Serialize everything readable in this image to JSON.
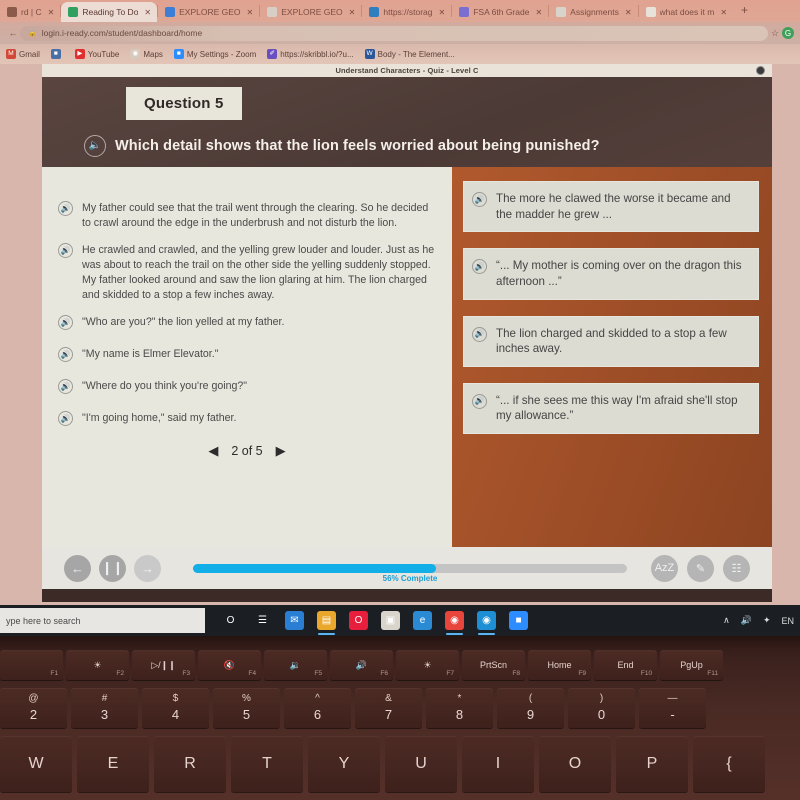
{
  "browser": {
    "tabs": [
      {
        "label": "rd | C",
        "favicon": "favicon-generic",
        "color": "#8a5a4a",
        "active": false,
        "close": "✕"
      },
      {
        "label": "Reading To Do",
        "favicon": "favicon-iready",
        "color": "#2fa05f",
        "active": true,
        "close": "✕"
      },
      {
        "label": "EXPLORE GEO",
        "favicon": "favicon-explore",
        "color": "#3d7fd6",
        "active": false,
        "close": "✕"
      },
      {
        "label": "EXPLORE GEO",
        "favicon": "favicon-doc",
        "color": "#d7cfc6",
        "active": false,
        "close": "✕"
      },
      {
        "label": "https://storag",
        "favicon": "favicon-globe",
        "color": "#2f7fbf",
        "active": false,
        "close": "✕"
      },
      {
        "label": "FSA 6th Grade",
        "favicon": "favicon-people",
        "color": "#7a6fd0",
        "active": false,
        "close": "✕"
      },
      {
        "label": "Assignments",
        "favicon": "favicon-word",
        "color": "#d9d4cb",
        "active": false,
        "close": "✕"
      },
      {
        "label": "what does it m",
        "favicon": "favicon-google",
        "color": "#e8e3da",
        "active": false,
        "close": "✕"
      }
    ],
    "new_tab_label": "+",
    "address": "login.i-ready.com/student/dashboard/home",
    "lock_icon": "🔒",
    "star_icon": "☆",
    "profile_initial": "G",
    "bookmarks": [
      {
        "label": "Gmail",
        "icon": "M",
        "color": "#d14836"
      },
      {
        "label": "",
        "icon": "■",
        "color": "#4a6fa5"
      },
      {
        "label": "YouTube",
        "icon": "▶",
        "color": "#e02f2f"
      },
      {
        "label": "Maps",
        "icon": "◉",
        "color": "#d8c9bd"
      },
      {
        "label": "My Settings - Zoom",
        "icon": "■",
        "color": "#2d8cff"
      },
      {
        "label": "https://skribbl.io/?u...",
        "icon": "✐",
        "color": "#6a4fc0"
      },
      {
        "label": "Body - The Element...",
        "icon": "W",
        "color": "#2b579a"
      }
    ]
  },
  "app": {
    "title": "Understand Characters - Quiz - Level C",
    "close_icon": "✕",
    "question_badge": "Question 5",
    "prompt": "Which detail shows that the lion feels worried about being punished?",
    "speaker_glyph": "🔊",
    "passage": [
      "My father could see that the trail went through the clearing. So he decided to crawl around the edge in the underbrush and not disturb the lion.",
      "He crawled and crawled, and the yelling grew louder and louder. Just as he was about to reach the trail on the other side the yelling suddenly stopped. My father looked around and saw the lion glaring at him. The lion charged and skidded to a stop a few inches away.",
      "\"Who are you?\" the lion yelled at my father.",
      "\"My name is Elmer Elevator.\"",
      "\"Where do you think you're going?\"",
      "\"I'm going home,\" said my father."
    ],
    "pager": {
      "prev_icon": "◀",
      "label": "2 of 5",
      "next_icon": "▶"
    },
    "choices": [
      "The more he clawed the worse it became and the madder he grew ...",
      "“... My mother is coming over on the dragon this afternoon ...”",
      "The lion charged and skidded to a stop a few inches away.",
      "“... if she sees me this way I'm afraid she'll stop my allowance.”"
    ],
    "footer": {
      "back_icon": "←",
      "pause_icon": "❙❙",
      "forward_icon": "→",
      "progress_percent": 56,
      "progress_label": "56% Complete",
      "progress_color": "#12aee8",
      "tools": [
        {
          "name": "dictionary-tool",
          "glyph": "AzZ"
        },
        {
          "name": "highlighter-tool",
          "glyph": "✎"
        },
        {
          "name": "notepad-tool",
          "glyph": "☷"
        }
      ]
    }
  },
  "taskbar": {
    "search_placeholder": "ype here to search",
    "apps": [
      {
        "name": "cortana",
        "glyph": "O",
        "color": "transparent",
        "active": false
      },
      {
        "name": "task-view",
        "glyph": "☰",
        "color": "transparent",
        "active": false
      },
      {
        "name": "mail",
        "glyph": "✉",
        "color": "#2a7fd4",
        "active": false
      },
      {
        "name": "file-explorer",
        "glyph": "▤",
        "color": "#e9a72c",
        "active": true
      },
      {
        "name": "opera",
        "glyph": "O",
        "color": "#e81e3d",
        "active": false
      },
      {
        "name": "store",
        "glyph": "▣",
        "color": "#d9d5cc",
        "active": false
      },
      {
        "name": "edge",
        "glyph": "e",
        "color": "#2a8ad4",
        "active": false
      },
      {
        "name": "chrome",
        "glyph": "◉",
        "color": "#e8453c",
        "active": true
      },
      {
        "name": "skype",
        "glyph": "◉",
        "color": "#1e8fd4",
        "active": true
      },
      {
        "name": "zoom",
        "glyph": "■",
        "color": "#2d8cff",
        "active": false
      }
    ],
    "tray": [
      {
        "name": "show-hidden-icons",
        "glyph": "∧"
      },
      {
        "name": "volume-icon",
        "glyph": "🔊"
      },
      {
        "name": "bluetooth-icon",
        "glyph": "✦"
      },
      {
        "name": "language-indicator",
        "glyph": "EN"
      }
    ]
  },
  "keyboard": {
    "function_row": [
      {
        "main": "",
        "fk": "F1"
      },
      {
        "main": "☀",
        "fk": "F2"
      },
      {
        "main": "▷/❙❙",
        "fk": "F3"
      },
      {
        "main": "🔇",
        "fk": "F4"
      },
      {
        "main": "🔉",
        "fk": "F5"
      },
      {
        "main": "🔊",
        "fk": "F6"
      },
      {
        "main": "☀",
        "fk": "F7"
      },
      {
        "main": "PrtScn",
        "fk": "F8"
      },
      {
        "main": "Home",
        "fk": "F9"
      },
      {
        "main": "End",
        "fk": "F10"
      },
      {
        "main": "PgUp",
        "fk": "F11"
      }
    ],
    "number_row": [
      {
        "sup": "@",
        "num": "2"
      },
      {
        "sup": "#",
        "num": "3"
      },
      {
        "sup": "$",
        "num": "4"
      },
      {
        "sup": "%",
        "num": "5"
      },
      {
        "sup": "^",
        "num": "6"
      },
      {
        "sup": "&",
        "num": "7"
      },
      {
        "sup": "*",
        "num": "8"
      },
      {
        "sup": "(",
        "num": "9"
      },
      {
        "sup": ")",
        "num": "0"
      },
      {
        "sup": "—",
        "num": "-"
      }
    ],
    "letter_row": [
      "W",
      "E",
      "R",
      "T",
      "Y",
      "U",
      "I",
      "O",
      "P",
      "{"
    ]
  }
}
